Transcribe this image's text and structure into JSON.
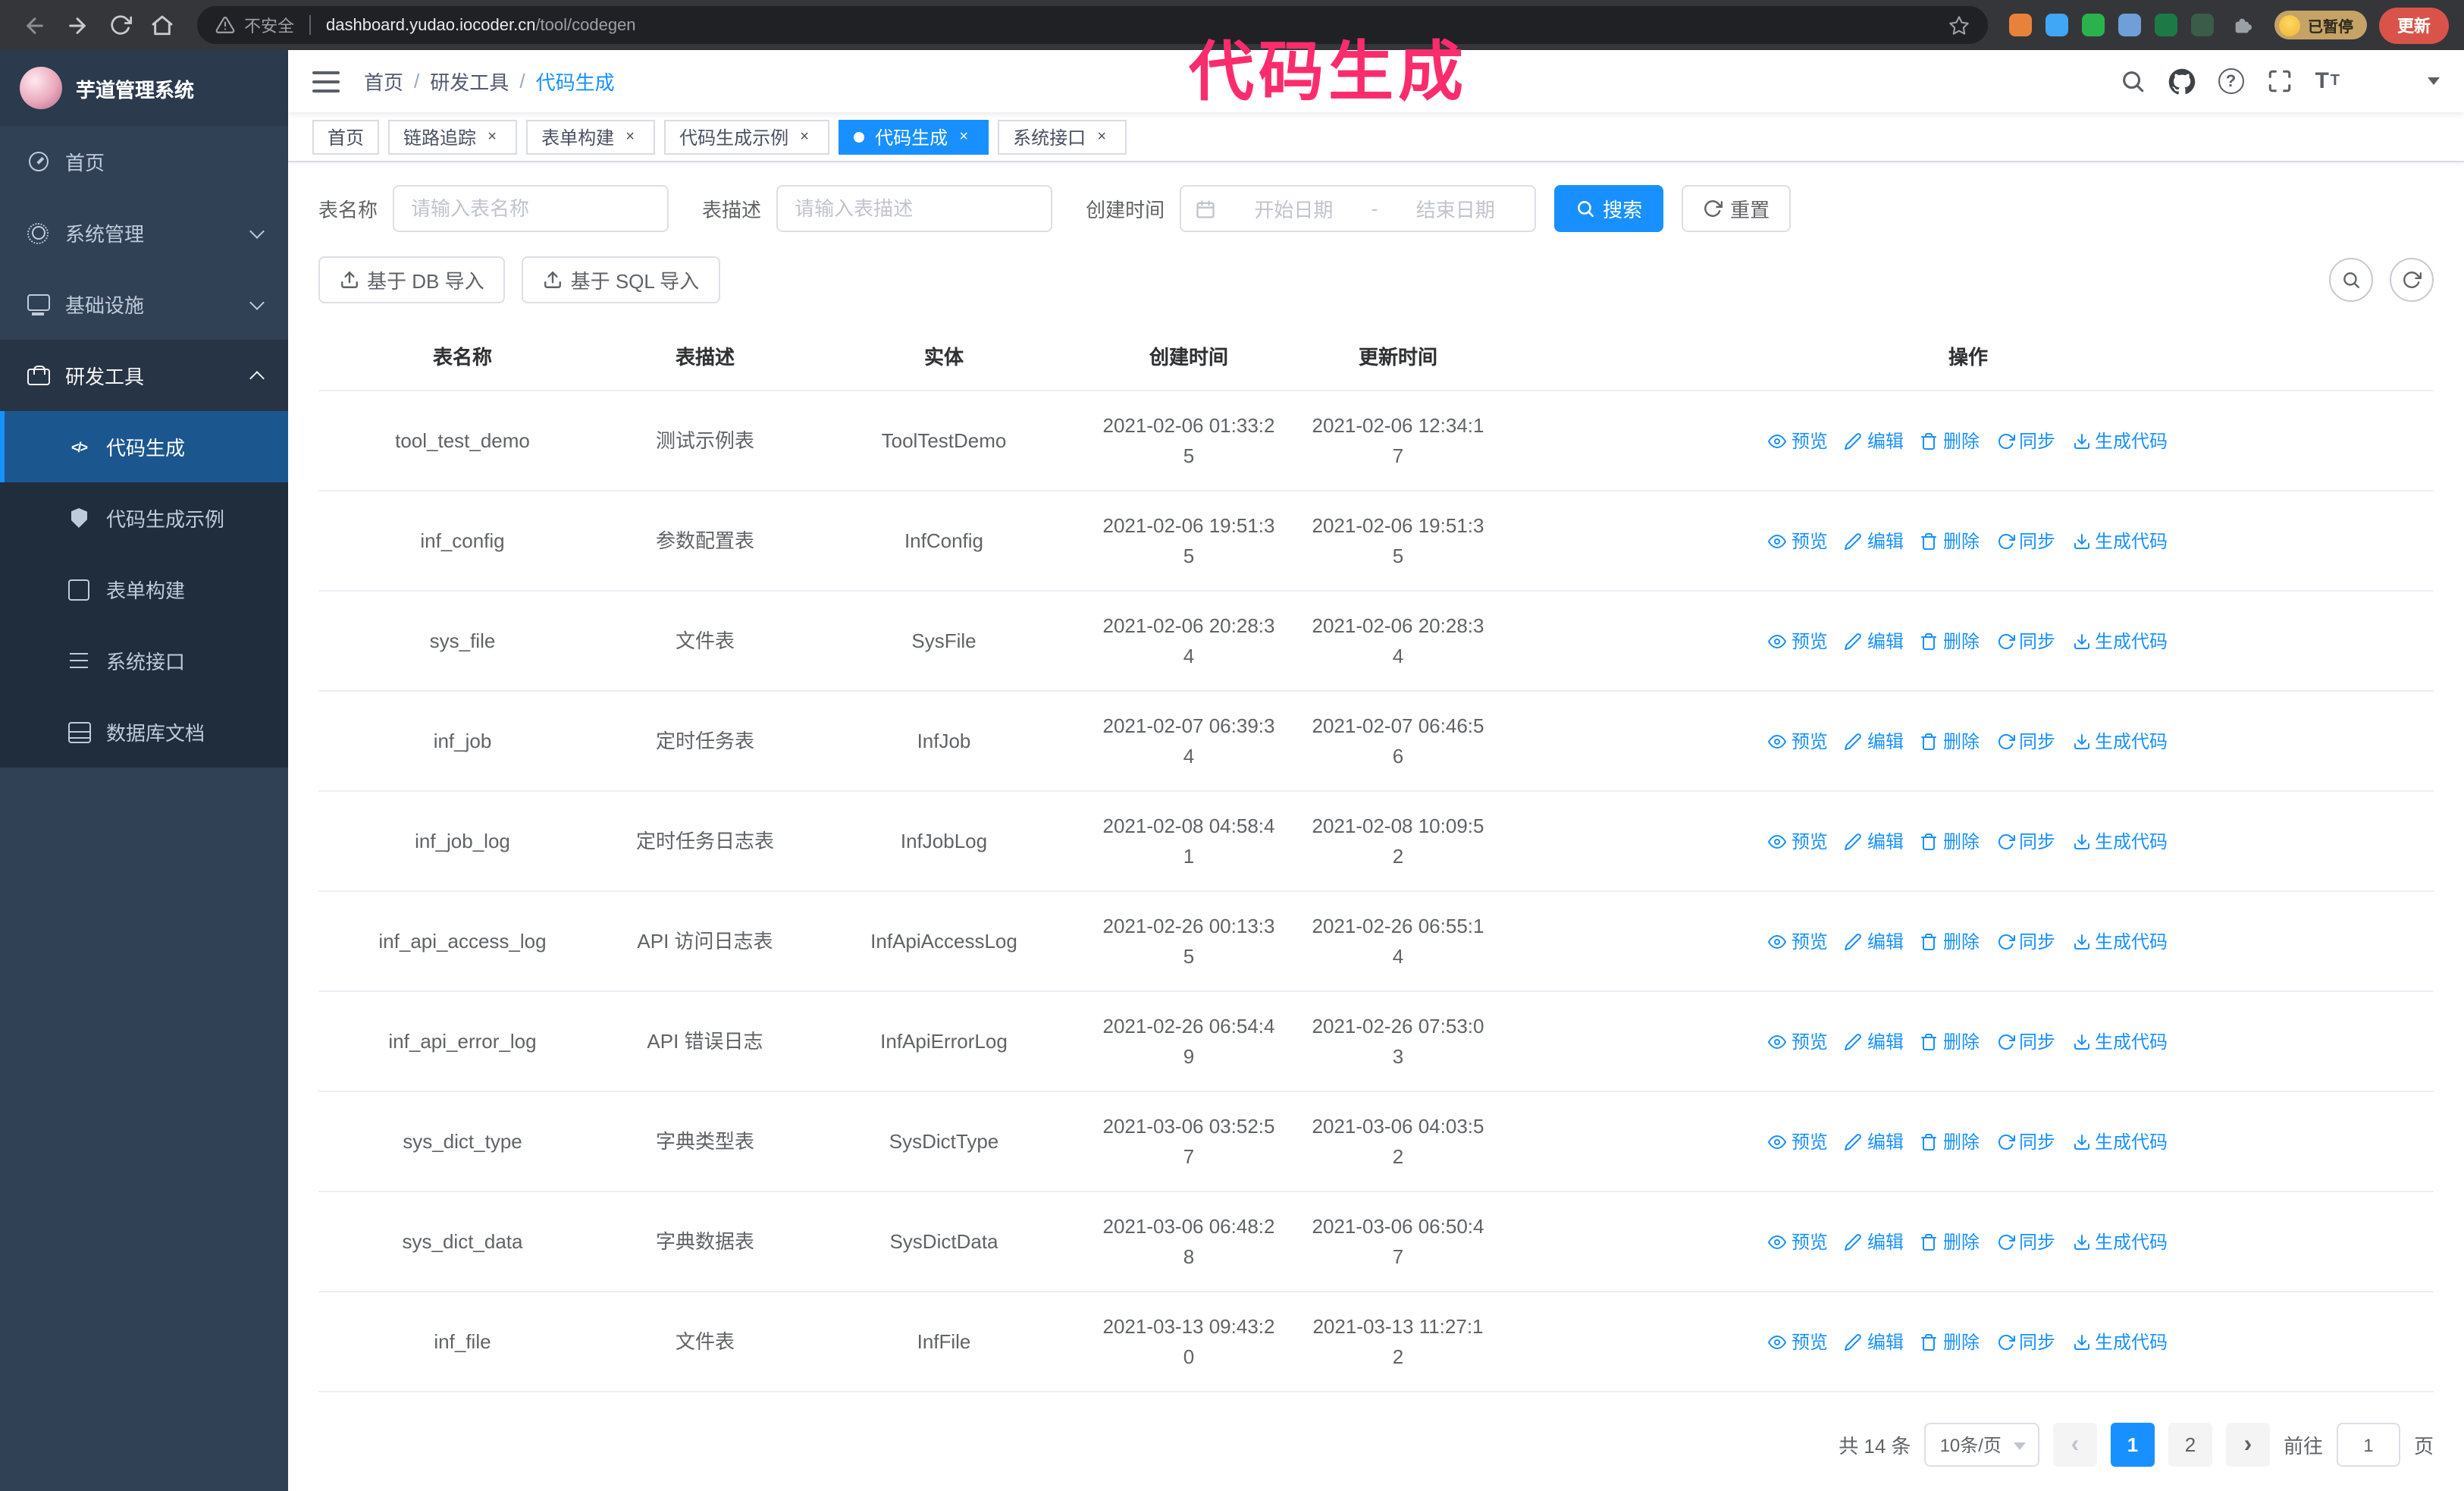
{
  "annotation": {
    "text": "代码生成",
    "color": "#fb2c6c"
  },
  "colors": {
    "primary": "#1890ff",
    "sidebar_bg": "#304156",
    "submenu_bg": "#1f2d3d"
  },
  "browser": {
    "security_text": "不安全",
    "url_host": "dashboard.yudao.iocoder.cn",
    "url_path": "/tool/codegen",
    "profile_chip": "已暂停",
    "update_button": "更新",
    "extensions": [
      {
        "name": "ext-orange-icon",
        "color": "#e8823b"
      },
      {
        "name": "ext-blue-drop-icon",
        "color": "#3fa7f5"
      },
      {
        "name": "ext-green-check-icon",
        "color": "#2bb24c"
      },
      {
        "name": "ext-people-icon",
        "color": "#6f9fd8"
      },
      {
        "name": "ext-green-dark-icon",
        "color": "#1d7a46"
      },
      {
        "name": "ext-forest-icon",
        "color": "#3a5c48"
      }
    ]
  },
  "sidebar": {
    "logo_title": "芋道管理系统",
    "menu": [
      {
        "label": "首页",
        "icon": "dashboard-icon",
        "expandable": false,
        "expanded": false
      },
      {
        "label": "系统管理",
        "icon": "gear-icon",
        "expandable": true,
        "expanded": false
      },
      {
        "label": "基础设施",
        "icon": "infra-icon",
        "expandable": true,
        "expanded": false
      },
      {
        "label": "研发工具",
        "icon": "tools-icon",
        "expandable": true,
        "expanded": true
      }
    ],
    "submenu": [
      {
        "label": "代码生成",
        "icon": "code-icon",
        "active": true
      },
      {
        "label": "代码生成示例",
        "icon": "shield-icon",
        "active": false
      },
      {
        "label": "表单构建",
        "icon": "form-icon",
        "active": false
      },
      {
        "label": "系统接口",
        "icon": "api-icon",
        "active": false
      },
      {
        "label": "数据库文档",
        "icon": "db-icon",
        "active": false
      }
    ]
  },
  "navbar": {
    "breadcrumb": [
      "首页",
      "研发工具",
      "代码生成"
    ],
    "icons": [
      "search-icon",
      "github-icon",
      "question-icon",
      "fullscreen-icon",
      "font-size-icon",
      "avatar",
      "caret-down-icon"
    ]
  },
  "tags": [
    {
      "label": "首页",
      "closable": false,
      "active": false
    },
    {
      "label": "链路追踪",
      "closable": true,
      "active": false
    },
    {
      "label": "表单构建",
      "closable": true,
      "active": false
    },
    {
      "label": "代码生成示例",
      "closable": true,
      "active": false
    },
    {
      "label": "代码生成",
      "closable": true,
      "active": true
    },
    {
      "label": "系统接口",
      "closable": true,
      "active": false
    }
  ],
  "filters": {
    "table_name_label": "表名称",
    "table_name_placeholder": "请输入表名称",
    "table_desc_label": "表描述",
    "table_desc_placeholder": "请输入表描述",
    "create_time_label": "创建时间",
    "date_start_placeholder": "开始日期",
    "date_separator": "-",
    "date_end_placeholder": "结束日期",
    "search_button": "搜索",
    "reset_button": "重置"
  },
  "toolbar": {
    "import_db": "基于 DB 导入",
    "import_sql": "基于 SQL 导入"
  },
  "table": {
    "columns": [
      "表名称",
      "表描述",
      "实体",
      "创建时间",
      "更新时间",
      "操作"
    ],
    "actions": [
      "预览",
      "编辑",
      "删除",
      "同步",
      "生成代码"
    ],
    "rows": [
      {
        "name": "tool_test_demo",
        "desc": "测试示例表",
        "entity": "ToolTestDemo",
        "created": "2021-02-06 01:33:25",
        "updated": "2021-02-06 12:34:17"
      },
      {
        "name": "inf_config",
        "desc": "参数配置表",
        "entity": "InfConfig",
        "created": "2021-02-06 19:51:35",
        "updated": "2021-02-06 19:51:35"
      },
      {
        "name": "sys_file",
        "desc": "文件表",
        "entity": "SysFile",
        "created": "2021-02-06 20:28:34",
        "updated": "2021-02-06 20:28:34"
      },
      {
        "name": "inf_job",
        "desc": "定时任务表",
        "entity": "InfJob",
        "created": "2021-02-07 06:39:34",
        "updated": "2021-02-07 06:46:56"
      },
      {
        "name": "inf_job_log",
        "desc": "定时任务日志表",
        "entity": "InfJobLog",
        "created": "2021-02-08 04:58:41",
        "updated": "2021-02-08 10:09:52"
      },
      {
        "name": "inf_api_access_log",
        "desc": "API 访问日志表",
        "entity": "InfApiAccessLog",
        "created": "2021-02-26 00:13:35",
        "updated": "2021-02-26 06:55:14"
      },
      {
        "name": "inf_api_error_log",
        "desc": "API 错误日志",
        "entity": "InfApiErrorLog",
        "created": "2021-02-26 06:54:49",
        "updated": "2021-02-26 07:53:03"
      },
      {
        "name": "sys_dict_type",
        "desc": "字典类型表",
        "entity": "SysDictType",
        "created": "2021-03-06 03:52:57",
        "updated": "2021-03-06 04:03:52"
      },
      {
        "name": "sys_dict_data",
        "desc": "字典数据表",
        "entity": "SysDictData",
        "created": "2021-03-06 06:48:28",
        "updated": "2021-03-06 06:50:47"
      },
      {
        "name": "inf_file",
        "desc": "文件表",
        "entity": "InfFile",
        "created": "2021-03-13 09:43:20",
        "updated": "2021-03-13 11:27:12"
      }
    ]
  },
  "pagination": {
    "total": "共 14 条",
    "page_size": "10条/页",
    "pages": [
      "1",
      "2"
    ],
    "active": "1",
    "goto_prefix": "前往",
    "goto_value": "1",
    "goto_suffix": "页"
  }
}
